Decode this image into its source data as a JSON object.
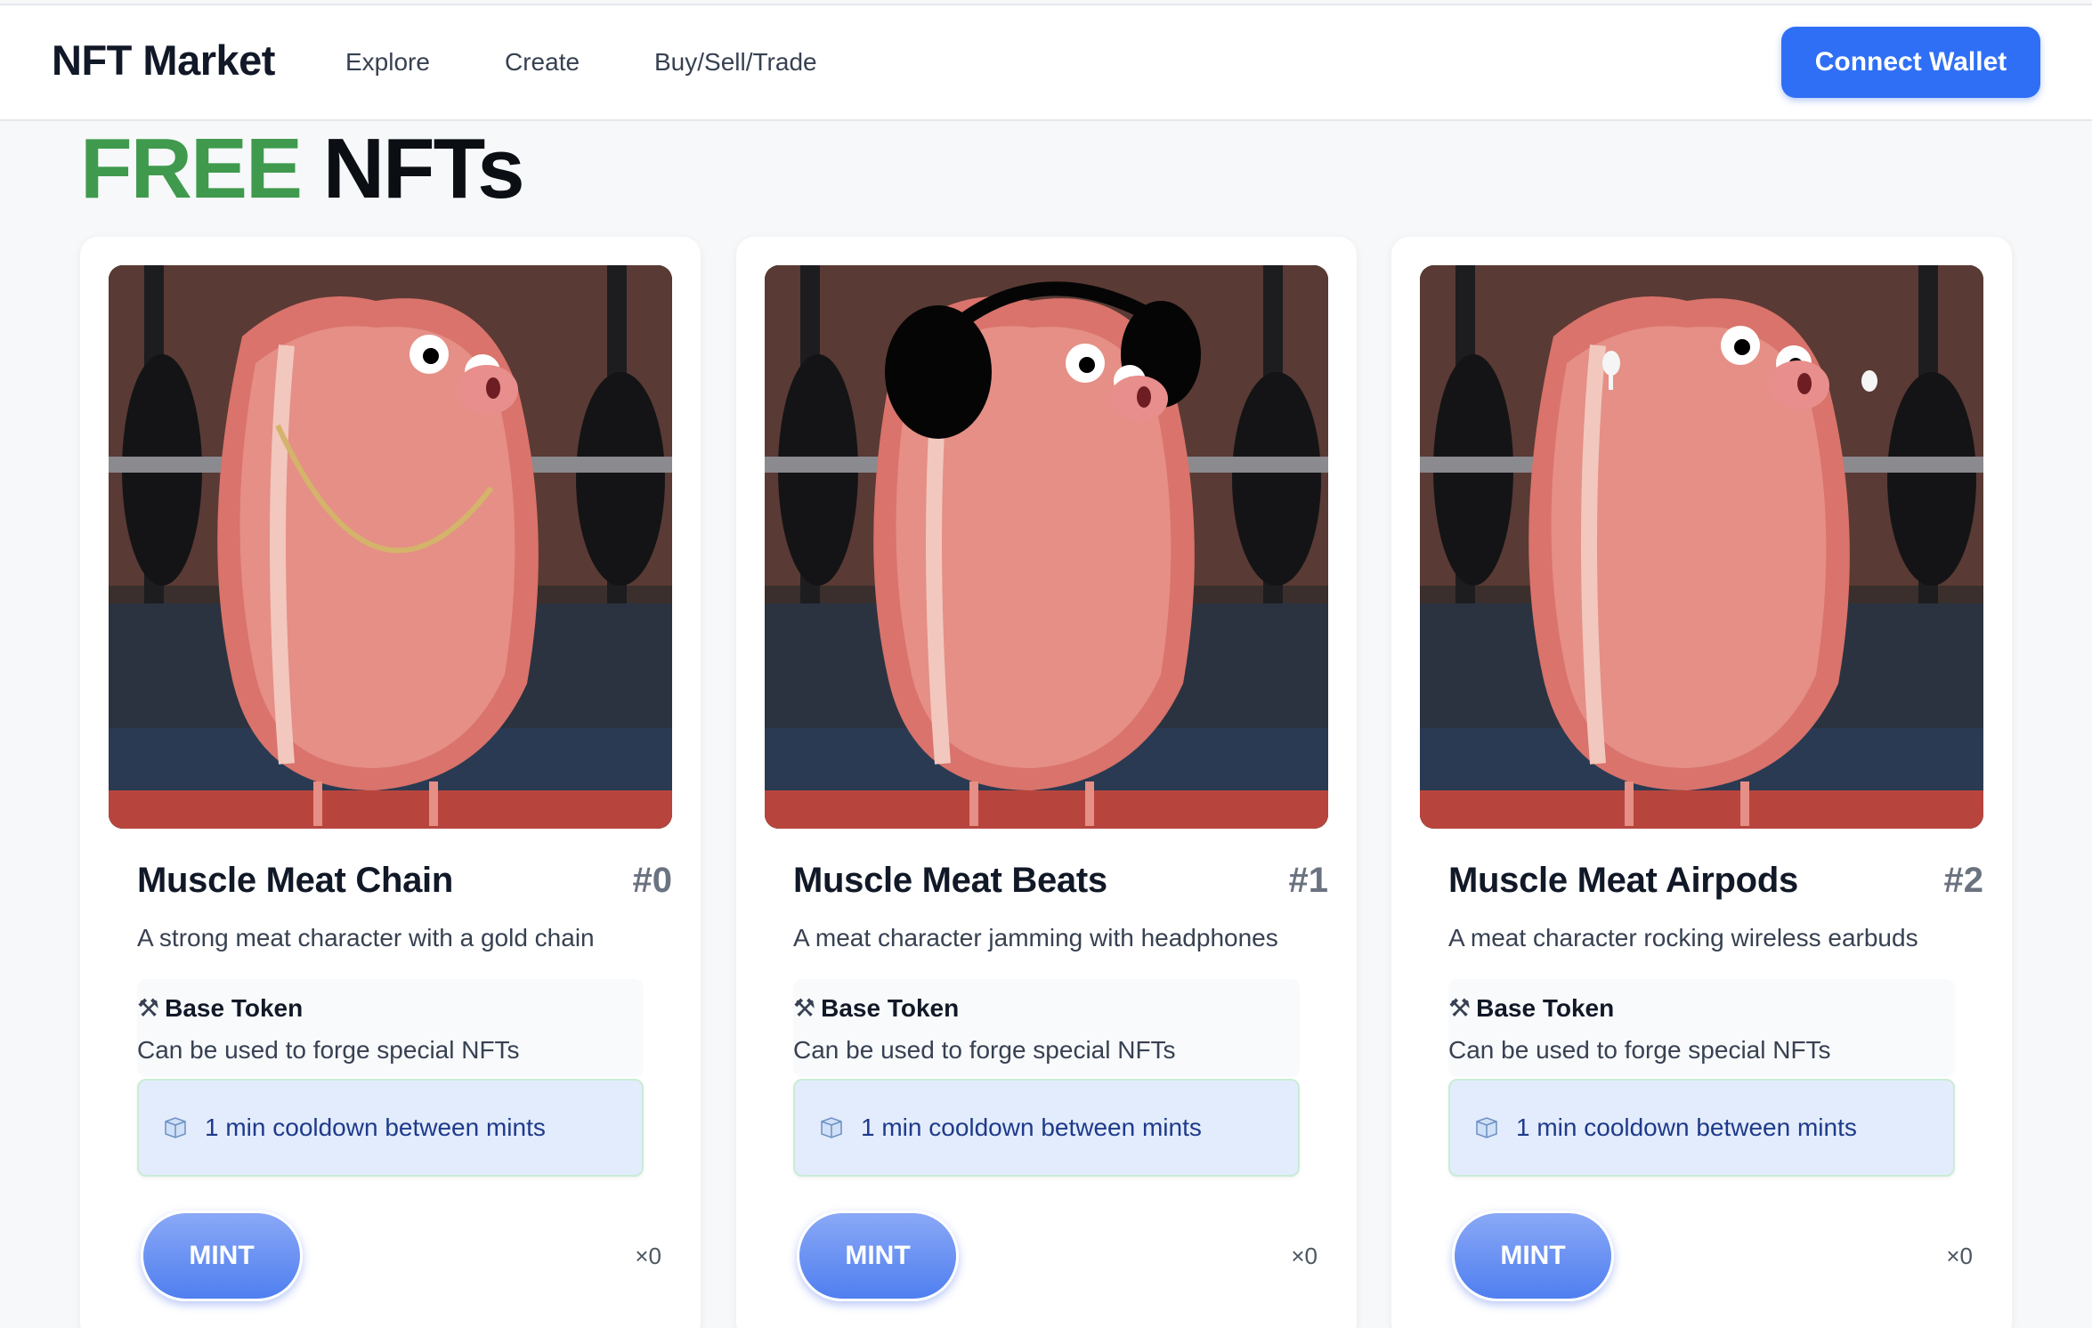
{
  "header": {
    "brand": "NFT Market",
    "nav": [
      "Explore",
      "Create",
      "Buy/Sell/Trade"
    ],
    "wallet_button": "Connect Wallet"
  },
  "page": {
    "title_highlight": "FREE",
    "title_rest": "NFTs"
  },
  "colors": {
    "accent_blue": "#2f6ff5",
    "free_green": "#3f9a4d",
    "cooldown_bg": "#e3ecfc"
  },
  "cards": [
    {
      "name": "Muscle Meat Chain",
      "number": "#0",
      "description": "A strong meat character with a gold chain",
      "token_icon": "hammer-pick-icon",
      "token_title": "Base Token",
      "token_desc": "Can be used to forge special NFTs",
      "cooldown_icon": "ice-cube-icon",
      "cooldown": "1 min cooldown between mints",
      "mint_label": "MINT",
      "count": "×0",
      "accessory": "gold chain"
    },
    {
      "name": "Muscle Meat Beats",
      "number": "#1",
      "description": "A meat character jamming with headphones",
      "token_icon": "hammer-pick-icon",
      "token_title": "Base Token",
      "token_desc": "Can be used to forge special NFTs",
      "cooldown_icon": "ice-cube-icon",
      "cooldown": "1 min cooldown between mints",
      "mint_label": "MINT",
      "count": "×0",
      "accessory": "headphones"
    },
    {
      "name": "Muscle Meat Airpods",
      "number": "#2",
      "description": "A meat character rocking wireless earbuds",
      "token_icon": "hammer-pick-icon",
      "token_title": "Base Token",
      "token_desc": "Can be used to forge special NFTs",
      "cooldown_icon": "ice-cube-icon",
      "cooldown": "1 min cooldown between mints",
      "mint_label": "MINT",
      "count": "×0",
      "accessory": "wireless earbuds"
    }
  ]
}
